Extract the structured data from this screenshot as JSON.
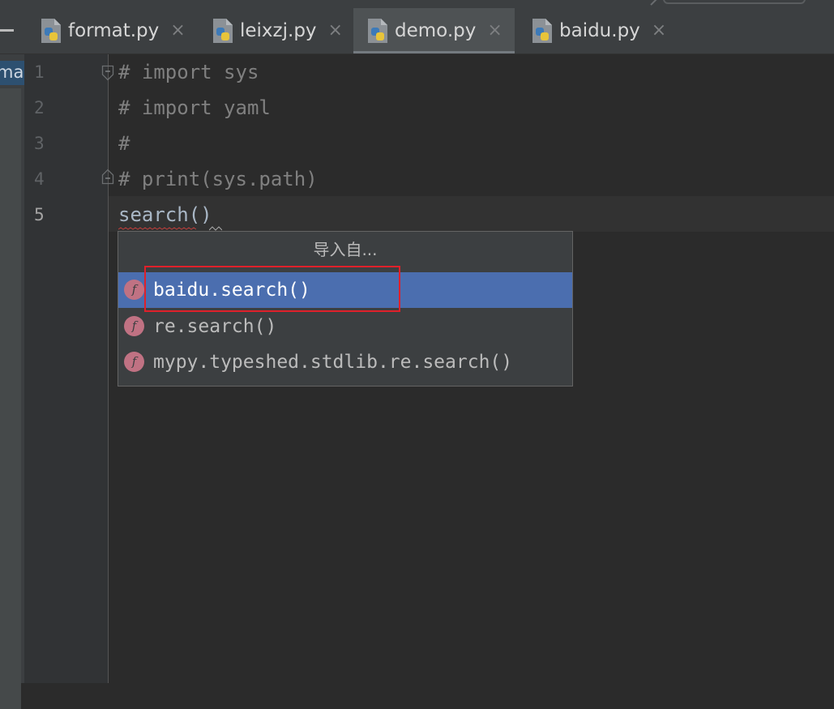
{
  "tabs": [
    {
      "label": "format.py",
      "icon": "python-file-icon",
      "active": false
    },
    {
      "label": "leixzj.py",
      "icon": "python-file-icon",
      "active": false
    },
    {
      "label": "demo.py",
      "icon": "python-file-icon",
      "active": true
    },
    {
      "label": "baidu.py",
      "icon": "python-file-icon",
      "active": false
    }
  ],
  "close_glyph": "×",
  "left_panel_label": "mar",
  "gutter": {
    "line_numbers": [
      "1",
      "2",
      "3",
      "4",
      "5"
    ],
    "current_line": "5"
  },
  "code_lines": [
    "# import sys",
    "# import yaml",
    "#",
    "# print(sys.path)",
    "search()"
  ],
  "import_popup": {
    "title": "导入自...",
    "items": [
      {
        "label": "baidu.search()",
        "icon": "function-icon",
        "icon_letter": "f",
        "selected": true
      },
      {
        "label": "re.search()",
        "icon": "function-icon",
        "icon_letter": "f",
        "selected": false
      },
      {
        "label": "mypy.typeshed.stdlib.re.search()",
        "icon": "function-icon",
        "icon_letter": "f",
        "selected": false
      }
    ]
  },
  "colors": {
    "editor_bg": "#2b2b2b",
    "selection": "#4b6eaf",
    "annotation_box": "#e0202a",
    "comment": "#808080",
    "code": "#a9b7c6"
  }
}
